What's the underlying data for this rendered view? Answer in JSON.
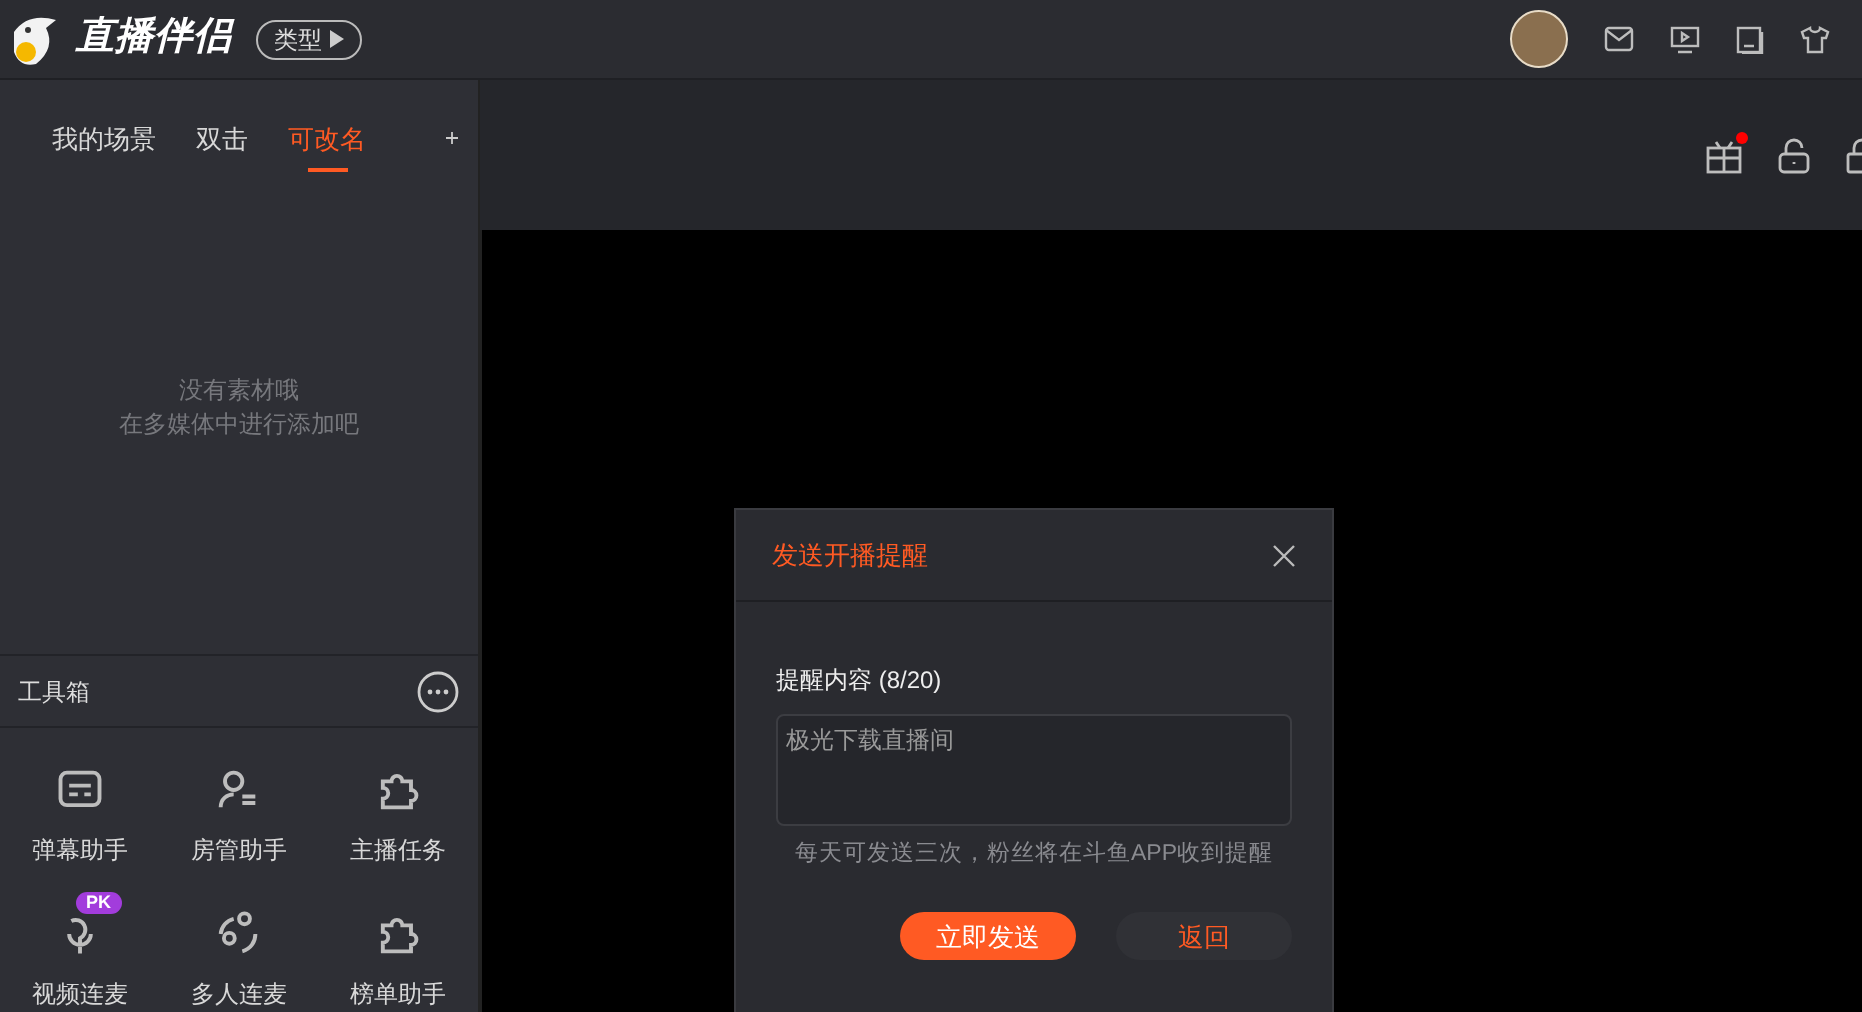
{
  "header": {
    "logo_text": "直播伴侣",
    "type_button": "类型"
  },
  "scene_tabs": [
    {
      "label": "我的场景",
      "selected": false
    },
    {
      "label": "双击",
      "selected": false
    },
    {
      "label": "可改名",
      "selected": true
    }
  ],
  "empty_message": [
    "没有素材哦",
    "在多媒体中进行添加吧"
  ],
  "toolbox": {
    "title": "工具箱",
    "tools": [
      {
        "label": "弹幕助手",
        "kind": "danmaku"
      },
      {
        "label": "房管助手",
        "kind": "admin"
      },
      {
        "label": "主播任务",
        "kind": "puzzle"
      },
      {
        "label": "视频连麦",
        "kind": "mic",
        "badge": "PK"
      },
      {
        "label": "多人连麦",
        "kind": "multi"
      },
      {
        "label": "榜单助手",
        "kind": "puzzle"
      }
    ]
  },
  "dialog": {
    "title": "发送开播提醒",
    "field_label": "提醒内容 (8/20)",
    "value": "极光下载直播间",
    "hint": "每天可发送三次，粉丝将在斗鱼APP收到提醒",
    "buttons": [
      {
        "label": "立即发送",
        "kind": "primary"
      },
      {
        "label": "返回",
        "kind": "secondary"
      }
    ]
  }
}
